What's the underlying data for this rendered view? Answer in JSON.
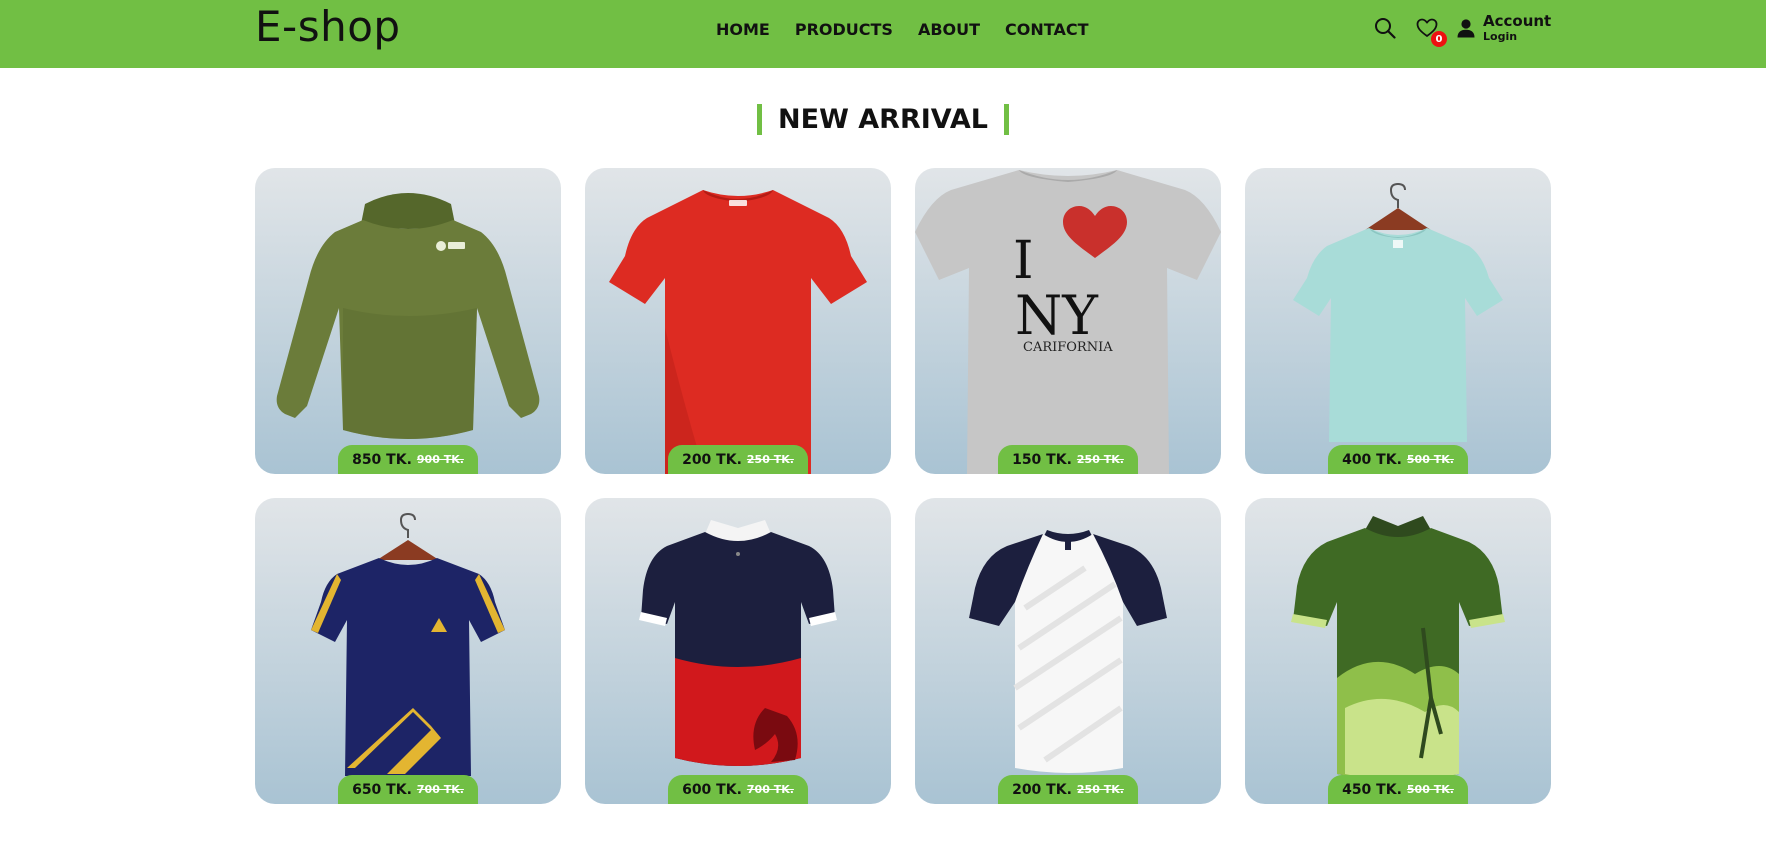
{
  "header": {
    "logo": "E-shop",
    "nav": [
      "HOME",
      "PRODUCTS",
      "ABOUT",
      "CONTACT"
    ],
    "wishlist_count": "0",
    "account_title": "Account",
    "account_sub": "Login",
    "bar_color": "#71bf44"
  },
  "section": {
    "title": "NEW ARRIVAL"
  },
  "products": [
    {
      "price": "850 TK.",
      "old_price": "900 TK.",
      "icon": "olive-hoodie"
    },
    {
      "price": "200 TK.",
      "old_price": "250 TK.",
      "icon": "red-tshirt"
    },
    {
      "price": "150 TK.",
      "old_price": "250 TK.",
      "icon": "grey-tshirt",
      "print": [
        "I",
        "NY",
        "CARIFORNIA"
      ]
    },
    {
      "price": "400 TK.",
      "old_price": "500 TK.",
      "icon": "mint-tshirt"
    },
    {
      "price": "650 TK.",
      "old_price": "700 TK.",
      "icon": "navy-tshirt"
    },
    {
      "price": "600 TK.",
      "old_price": "700 TK.",
      "icon": "red-navy-jersey"
    },
    {
      "price": "200 TK.",
      "old_price": "250 TK.",
      "icon": "white-navy-jersey"
    },
    {
      "price": "450 TK.",
      "old_price": "500 TK.",
      "icon": "green-polo"
    }
  ]
}
